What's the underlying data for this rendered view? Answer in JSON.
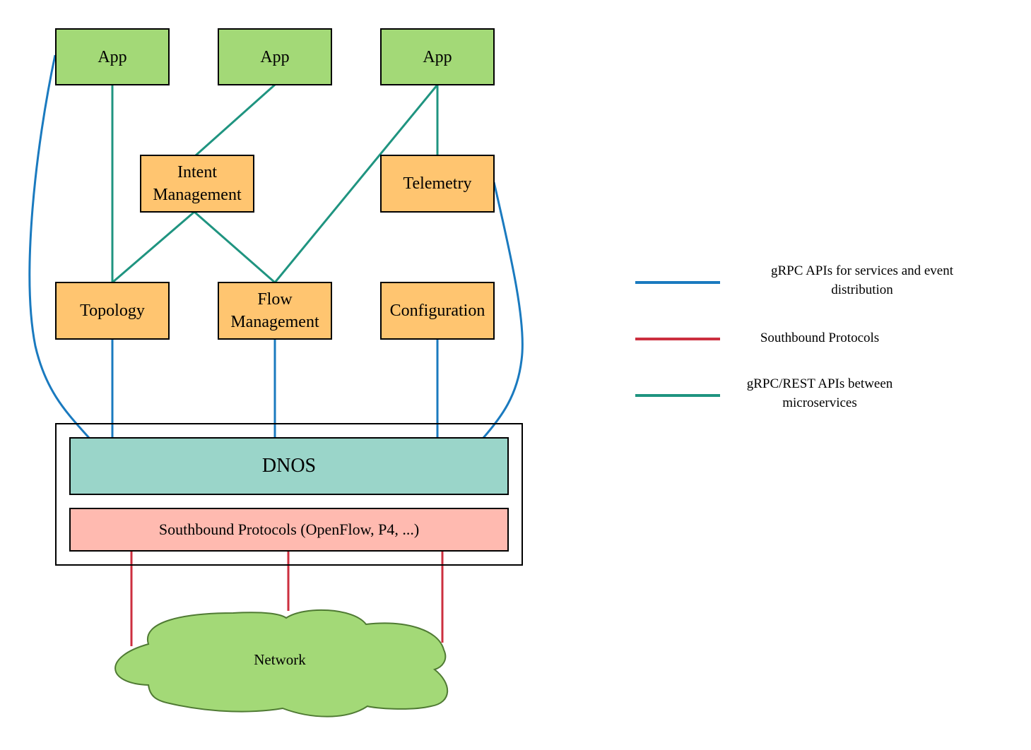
{
  "colors": {
    "grpc_services": "#1a7abf",
    "southbound": "#cc2f3f",
    "grpc_rest": "#1f9480",
    "app_fill": "#a3d977",
    "service_fill": "#ffc570",
    "dnos_fill": "#9ad5c9",
    "southbound_fill": "#ffbab0",
    "network_fill": "#a3d977"
  },
  "apps": [
    {
      "label": "App"
    },
    {
      "label": "App"
    },
    {
      "label": "App"
    }
  ],
  "services": {
    "intent": "Intent\nManagement",
    "telemetry": "Telemetry",
    "topology": "Topology",
    "flow": "Flow\nManagement",
    "configuration": "Configuration"
  },
  "dnos": {
    "label": "DNOS"
  },
  "southbound_box": {
    "label": "Southbound Protocols (OpenFlow, P4, ...)"
  },
  "network": {
    "label": "Network"
  },
  "legend": [
    {
      "label": "gRPC APIs for services  and event\ndistribution",
      "color_key": "grpc_services"
    },
    {
      "label": "Southbound Protocols",
      "color_key": "southbound"
    },
    {
      "label": "gRPC/REST APIs between\nmicroservices",
      "color_key": "grpc_rest"
    }
  ]
}
